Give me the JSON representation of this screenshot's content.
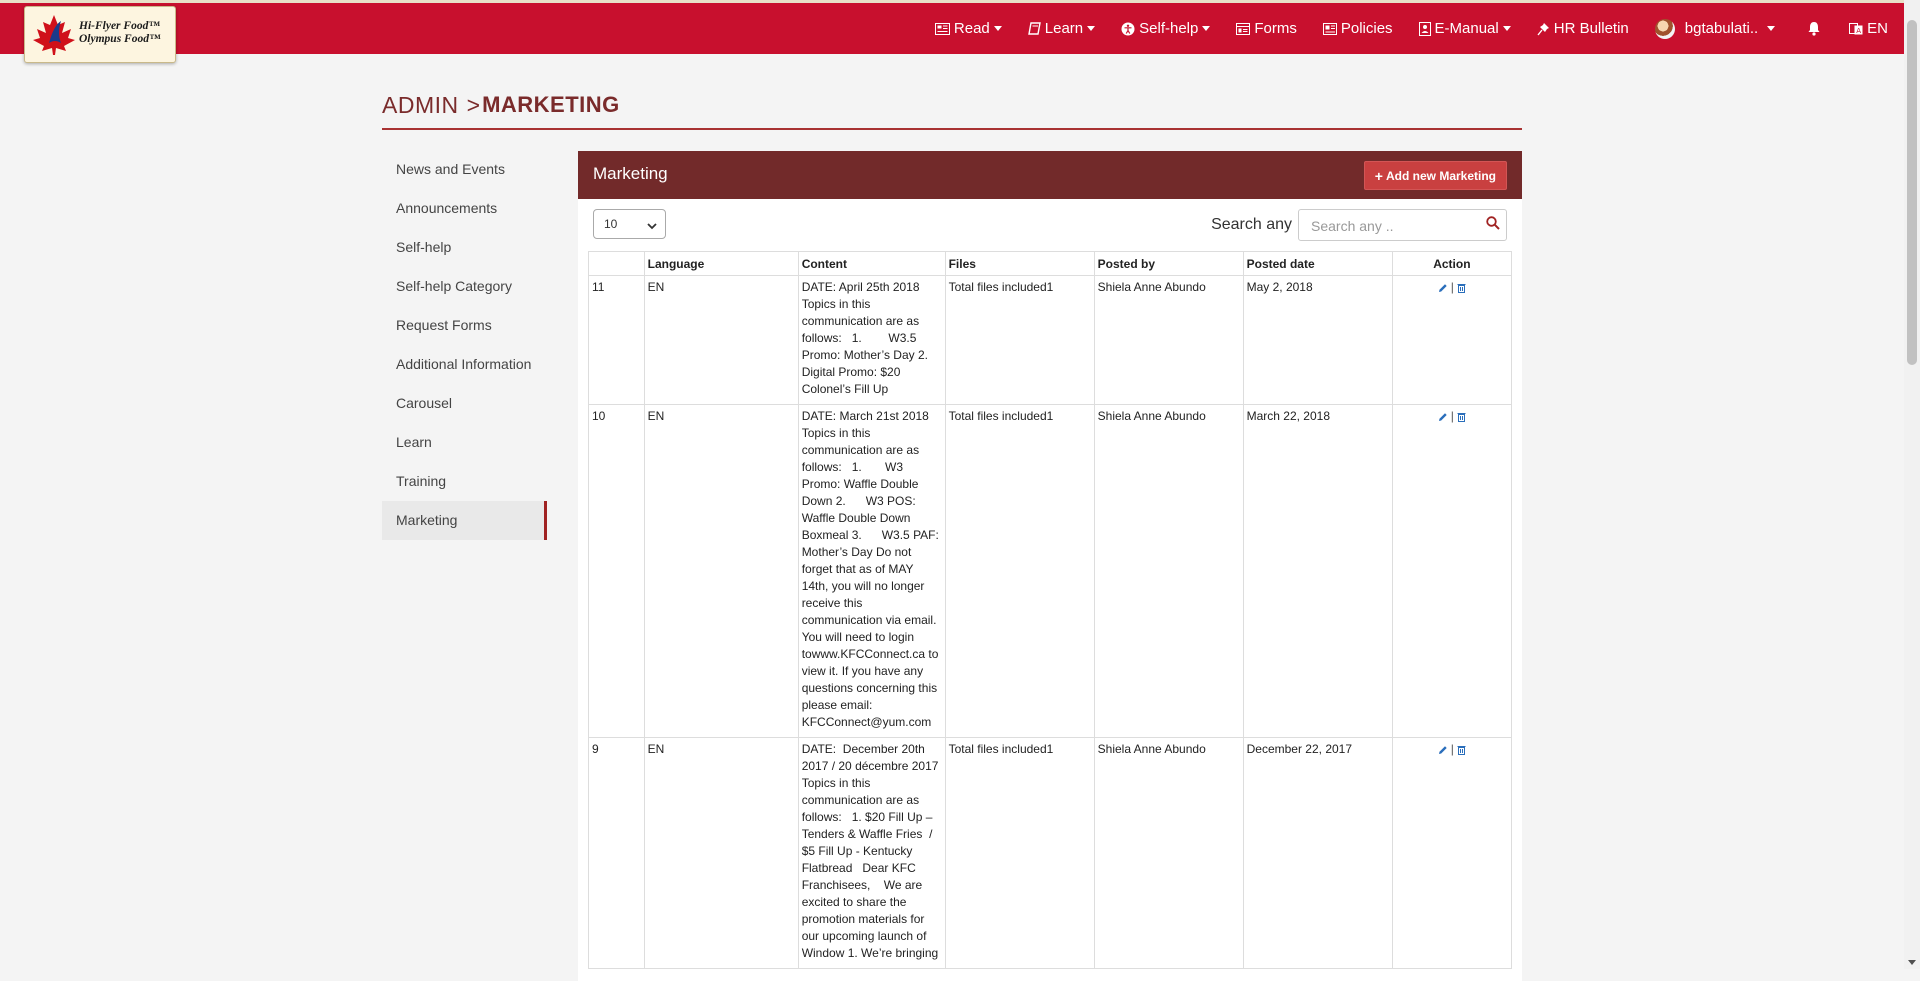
{
  "brand": {
    "line1": "Hi-Flyer Food™",
    "line2": "Olympus Food™"
  },
  "nav": {
    "read": "Read",
    "learn": "Learn",
    "self_help": "Self-help",
    "forms": "Forms",
    "policies": "Policies",
    "e_manual": "E-Manual",
    "hr_bulletin": "HR Bulletin",
    "user": "bgtabulati..",
    "language": "EN"
  },
  "breadcrumb": {
    "root": "ADMIN",
    "separator": ">",
    "current": "MARKETING"
  },
  "sidebar": {
    "items": [
      {
        "label": "News and Events"
      },
      {
        "label": "Announcements"
      },
      {
        "label": "Self-help"
      },
      {
        "label": "Self-help Category"
      },
      {
        "label": "Request Forms"
      },
      {
        "label": "Additional Information"
      },
      {
        "label": "Carousel"
      },
      {
        "label": "Learn"
      },
      {
        "label": "Training"
      },
      {
        "label": "Marketing"
      }
    ],
    "active": "Marketing"
  },
  "panel": {
    "title": "Marketing",
    "add_button": "Add new Marketing",
    "page_length": "10",
    "search_label": "Search any",
    "search_placeholder": "Search any .."
  },
  "table": {
    "columns": [
      "",
      "Language",
      "Content",
      "Files",
      "Posted by",
      "Posted date",
      "Action"
    ],
    "rows": [
      {
        "id": "11",
        "language": "EN",
        "content": "DATE: April 25th 2018 Topics in this communication are as follows:   1.        W3.5 Promo: Mother’s Day 2.       Digital Promo: $20 Colonel’s Fill Up",
        "files": "Total files included1",
        "posted_by": "Shiela Anne Abundo",
        "posted_date": "May 2, 2018"
      },
      {
        "id": "10",
        "language": "EN",
        "content": "DATE: March 21st 2018 Topics in this communication are as follows:   1.       W3 Promo: Waffle Double Down 2.      W3 POS: Waffle Double Down Boxmeal 3.      W3.5 PAF: Mother’s Day Do not forget that as of MAY 14th, you will no longer receive this communication via email. You will need to login towww.KFCConnect.ca to view it. If you have any questions concerning this please email: KFCConnect@yum.com",
        "files": "Total files included1",
        "posted_by": "Shiela Anne Abundo",
        "posted_date": "March 22, 2018"
      },
      {
        "id": "9",
        "language": "EN",
        "content": "DATE:  December 20th 2017 / 20 décembre 2017 Topics in this communication are as follows:   1. $20 Fill Up – Tenders & Waffle Fries  / $5 Fill Up - Kentucky Flatbread   Dear KFC Franchisees,    We are excited to share the promotion materials for our upcoming launch of Window 1. We’re bringing",
        "files": "Total files included1",
        "posted_by": "Shiela Anne Abundo",
        "posted_date": "December 22, 2017"
      }
    ]
  },
  "colors": {
    "navbar": "#c8102e",
    "panel_header": "#722a2a",
    "add_button": "#c94040",
    "accent_text": "#7a2b2b"
  }
}
